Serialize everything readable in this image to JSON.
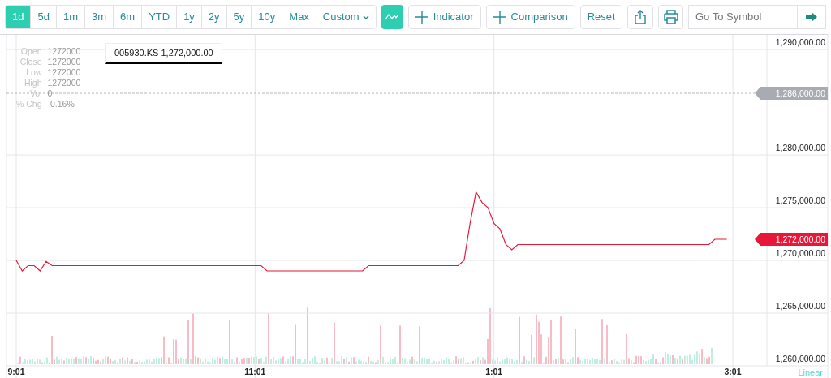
{
  "toolbar": {
    "ranges": [
      {
        "label": "1d",
        "selected": true
      },
      {
        "label": "5d",
        "selected": false
      },
      {
        "label": "1m",
        "selected": false
      },
      {
        "label": "3m",
        "selected": false
      },
      {
        "label": "6m",
        "selected": false
      },
      {
        "label": "YTD",
        "selected": false
      },
      {
        "label": "1y",
        "selected": false
      },
      {
        "label": "2y",
        "selected": false
      },
      {
        "label": "5y",
        "selected": false
      },
      {
        "label": "10y",
        "selected": false
      },
      {
        "label": "Max",
        "selected": false
      }
    ],
    "custom": {
      "label": "Custom"
    },
    "chart_style": {
      "selected": true
    },
    "indicator": {
      "label": "Indicator"
    },
    "comparison": {
      "label": "Comparison"
    },
    "reset": {
      "label": "Reset"
    },
    "search": {
      "placeholder": "Go To Symbol"
    }
  },
  "legend": [
    {
      "label": "Open",
      "value": "1272000"
    },
    {
      "label": "Close",
      "value": "1272000"
    },
    {
      "label": "Low",
      "value": "1272000"
    },
    {
      "label": "High",
      "value": "1272000"
    },
    {
      "label": "Vol",
      "value": "0"
    },
    {
      "label": "% Chg",
      "value": "-0.16%"
    }
  ],
  "tooltip_price": "1,272,000.00",
  "scale": "Linear",
  "chart_data": {
    "type": "line",
    "ylim": [
      1260000,
      1291470
    ],
    "grid": true,
    "categories": [
      "9:01",
      null,
      null,
      null,
      null,
      null,
      null,
      null,
      null,
      null,
      null,
      null,
      null,
      null,
      null,
      null,
      null,
      null,
      null,
      null,
      null,
      null,
      null,
      null,
      null,
      null,
      null,
      null,
      null,
      null,
      null,
      null,
      null,
      null,
      null,
      null,
      null,
      null,
      null,
      null,
      "11:01",
      null,
      null,
      null,
      null,
      null,
      null,
      null,
      null,
      null,
      null,
      null,
      null,
      null,
      null,
      null,
      null,
      null,
      null,
      null,
      null,
      null,
      null,
      null,
      null,
      null,
      null,
      null,
      null,
      null,
      null,
      null,
      null,
      null,
      null,
      null,
      null,
      null,
      null,
      null,
      "1:01",
      null,
      null,
      null,
      null,
      null,
      null,
      null,
      null,
      null,
      null,
      null,
      null,
      null,
      null,
      null,
      null,
      null,
      null,
      null,
      null,
      null,
      null,
      null,
      null,
      null,
      null,
      null,
      null,
      null,
      null,
      null,
      null,
      null,
      null,
      null,
      null,
      null,
      null,
      null,
      "3:01"
    ],
    "yticks": [
      {
        "value": 1260000,
        "label": "1,260,000.00"
      },
      {
        "value": 1265000,
        "label": "1,265,000.00"
      },
      {
        "value": 1270000,
        "label": "1,270,000.00"
      },
      {
        "value": 1275000,
        "label": "1,275,000.00"
      },
      {
        "value": 1280000,
        "label": "1,280,000.00"
      },
      {
        "value": 1290000,
        "label": "1,290,000.00"
      }
    ],
    "series": [
      {
        "name": "005930.KS",
        "color": "#e8173a",
        "values": [
          1270000,
          1269000,
          1269500,
          1269500,
          1269000,
          1269900,
          1269500,
          1269500,
          1269500,
          1269500,
          1269500,
          1269500,
          1269500,
          1269500,
          1269500,
          1269500,
          1269500,
          1269500,
          1269500,
          1269500,
          1269500,
          1269500,
          1269500,
          1269500,
          1269500,
          1269500,
          1269500,
          1269500,
          1269500,
          1269500,
          1269500,
          1269500,
          1269500,
          1269500,
          1269500,
          1269500,
          1269500,
          1269500,
          1269500,
          1269500,
          1269500,
          1269500,
          1269000,
          1269000,
          1269000,
          1269000,
          1269000,
          1269000,
          1269000,
          1269000,
          1269000,
          1269000,
          1269000,
          1269000,
          1269000,
          1269000,
          1269000,
          1269000,
          1269000,
          1269500,
          1269500,
          1269500,
          1269500,
          1269500,
          1269500,
          1269500,
          1269500,
          1269500,
          1269500,
          1269500,
          1269500,
          1269500,
          1269500,
          1269500,
          1269500,
          1270000,
          1273500,
          1276500,
          1275500,
          1275000,
          1273500,
          1273000,
          1271500,
          1271000,
          1271500,
          1271500,
          1271500,
          1271500,
          1271500,
          1271500,
          1271500,
          1271500,
          1271500,
          1271500,
          1271500,
          1271500,
          1271500,
          1271500,
          1271500,
          1271500,
          1271500,
          1271500,
          1271500,
          1271500,
          1271500,
          1271500,
          1271500,
          1271500,
          1271500,
          1271500,
          1271500,
          1271500,
          1271500,
          1271500,
          1271500,
          1271500,
          1271500,
          1272000,
          1272000,
          1272000,
          null
        ]
      }
    ]
  },
  "price_tags": [
    {
      "kind": "previous_close",
      "label": "1,286,000.00"
    },
    {
      "kind": "last_price",
      "label": "1,272,000.00"
    }
  ]
}
